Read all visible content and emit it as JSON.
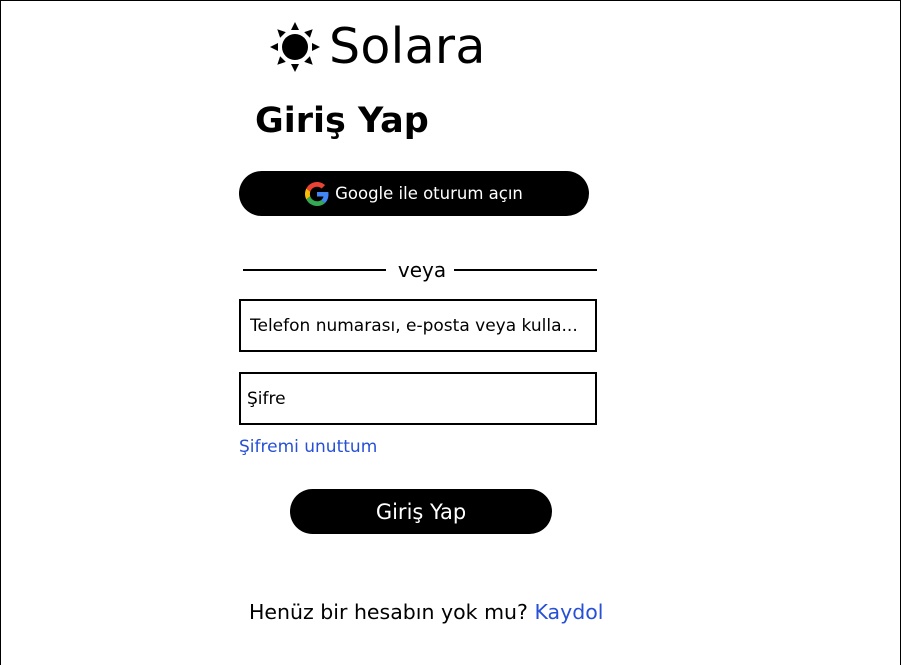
{
  "brand": {
    "icon": "sun-icon",
    "name": "Solara"
  },
  "page": {
    "title": "Giriş Yap"
  },
  "google_button": {
    "icon": "google-icon",
    "label": "Google ile oturum açın"
  },
  "divider": {
    "text": "veya"
  },
  "form": {
    "username": {
      "value": "",
      "placeholder": "Telefon numarası, e-posta veya kulla..."
    },
    "password": {
      "value": "",
      "placeholder": "Şifre"
    },
    "forgot_label": "Şifremi unuttum",
    "submit_label": "Giriş Yap"
  },
  "signup": {
    "prompt": "Henüz bir hesabın yok mu?",
    "link_label": "Kaydol"
  },
  "colors": {
    "background": "#ffffff",
    "button": "#000000",
    "button_text": "#ffffff",
    "link": "#2650d6",
    "border": "#000000"
  }
}
